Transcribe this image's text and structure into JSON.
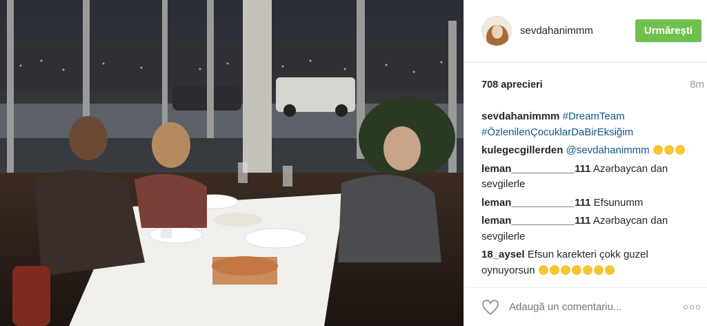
{
  "header": {
    "username": "sevdahanimmm",
    "follow_label": "Urmărești"
  },
  "post": {
    "likes": "708 aprecieri",
    "time": "8m"
  },
  "caption": {
    "user": "sevdahanimmm",
    "tags": "#DreamTeam #ÖzlenilenÇocuklarDaBirEksiğim"
  },
  "comments": [
    {
      "user": "kulegecgillerden",
      "text": "@sevdahanimmm",
      "emoji_count": 3,
      "emoji_icon": "astonished-face-icon"
    },
    {
      "user": "leman___________111",
      "text": "Azərbaycan dan sevgilerle",
      "emoji_count": 0
    },
    {
      "user": "leman___________111",
      "text": "Efsunumm",
      "emoji_count": 0
    },
    {
      "user": "leman___________111",
      "text": "Azərbaycan dan sevgilerle",
      "emoji_count": 0
    },
    {
      "user": "18_aysel",
      "text": "Efsun karekteri çokk guzel oynuyorsun",
      "emoji_count": 7,
      "emoji_icon": "smiling-face-icon"
    }
  ],
  "footer": {
    "comment_placeholder": "Adaugă un comentariu...",
    "like_icon": "heart-outline-icon",
    "more_icon": "more-options-icon"
  },
  "colors": {
    "follow": "#70c050",
    "link": "#125688",
    "muted": "#999999"
  }
}
